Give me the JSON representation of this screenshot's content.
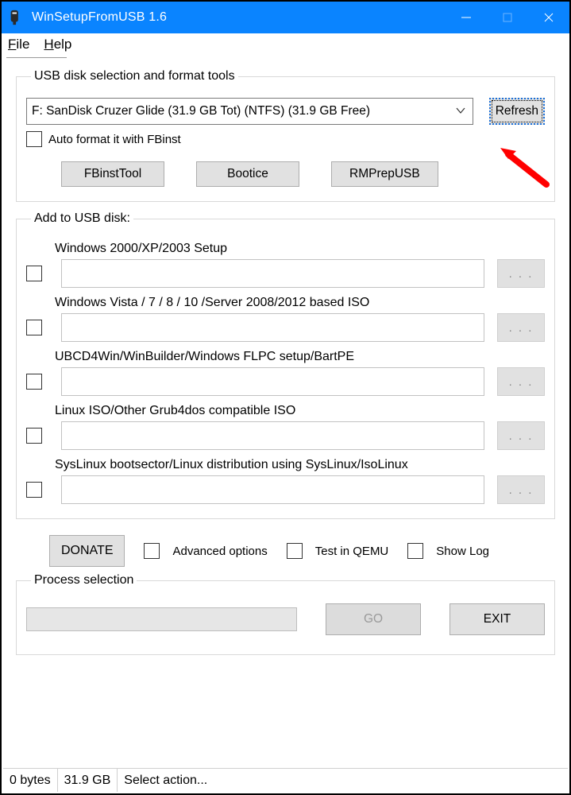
{
  "title": "WinSetupFromUSB 1.6",
  "menu": {
    "file": "File",
    "help": "Help"
  },
  "usb_group": {
    "legend": "USB disk selection and format tools",
    "selected_disk": "F: SanDisk Cruzer Glide (31.9 GB Tot) (NTFS) (31.9 GB Free)",
    "refresh": "Refresh",
    "auto_format": "Auto format it with FBinst",
    "fbinst": "FBinstTool",
    "bootice": "Bootice",
    "rmprep": "RMPrepUSB"
  },
  "add_group": {
    "legend": "Add to USB disk:",
    "browse": ". . .",
    "entries": [
      "Windows 2000/XP/2003 Setup",
      "Windows Vista / 7 / 8 / 10 /Server 2008/2012 based ISO",
      "UBCD4Win/WinBuilder/Windows FLPC setup/BartPE",
      "Linux ISO/Other Grub4dos compatible ISO",
      "SysLinux bootsector/Linux distribution using SysLinux/IsoLinux"
    ]
  },
  "options": {
    "donate": "DONATE",
    "advanced": "Advanced options",
    "qemu": "Test in QEMU",
    "showlog": "Show Log"
  },
  "process_group": {
    "legend": "Process selection",
    "go": "GO",
    "exit": "EXIT"
  },
  "status": {
    "bytes": "0 bytes",
    "size": "31.9 GB",
    "action": "Select action..."
  }
}
